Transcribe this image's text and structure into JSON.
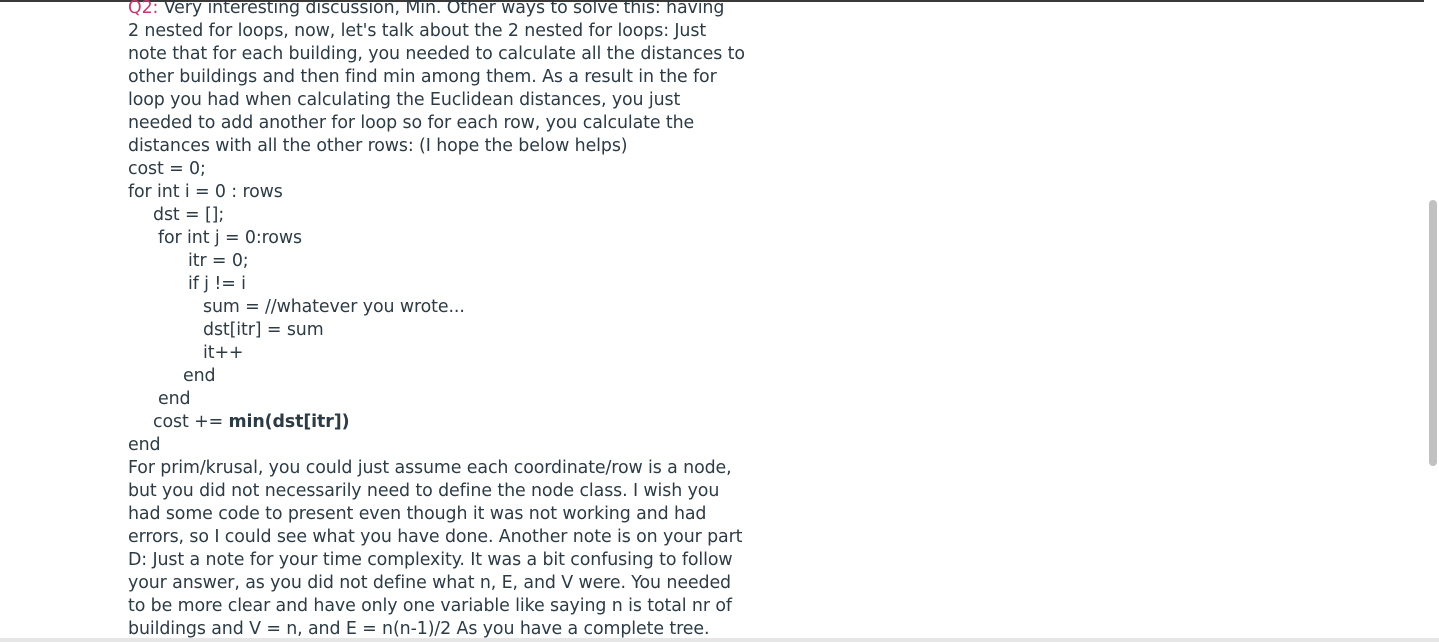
{
  "comment": {
    "label": "Q2:",
    "lines": [
      " Very interesting discussion, Min. Other ways to solve this: having",
      "2 nested for loops, now, let's talk about the 2 nested for loops: Just",
      "note that for each building, you needed to calculate all the distances to",
      "other buildings and then find min among them. As a result in the for",
      "loop you had when calculating the Euclidean distances, you just",
      "needed to add another for loop so for each row, you calculate the",
      "distances with all the other rows: (I hope the below helps)"
    ],
    "code": [
      "cost = 0;",
      "for int i = 0 : rows",
      "dst = [];",
      "for int j = 0:rows",
      "itr = 0;",
      "if j != i",
      "sum = //whatever you wrote...",
      "dst[itr] =  sum",
      "it++",
      "end",
      "end",
      "cost +=",
      "min(dst[itr])",
      "end"
    ],
    "closing_lines": [
      "For prim/krusal, you could just assume each coordinate/row is a node,",
      "but you did not necessarily need to define the node class. I wish you",
      "had some code to present even though it was not working and had",
      "errors, so I could see what you have done. Another note is on your part",
      "D: Just a note for your time complexity. It was a bit confusing to follow",
      "your answer, as you did not define what n, E, and V were. You needed",
      "to be more clear and have only one variable like saying n is total nr of",
      "buildings and V = n, and E = n(n-1)/2 As you have a complete tree."
    ]
  },
  "colors": {
    "label": "#c23c71",
    "text": "#2d3b45",
    "scrollbar_thumb": "#c1c1c1"
  }
}
